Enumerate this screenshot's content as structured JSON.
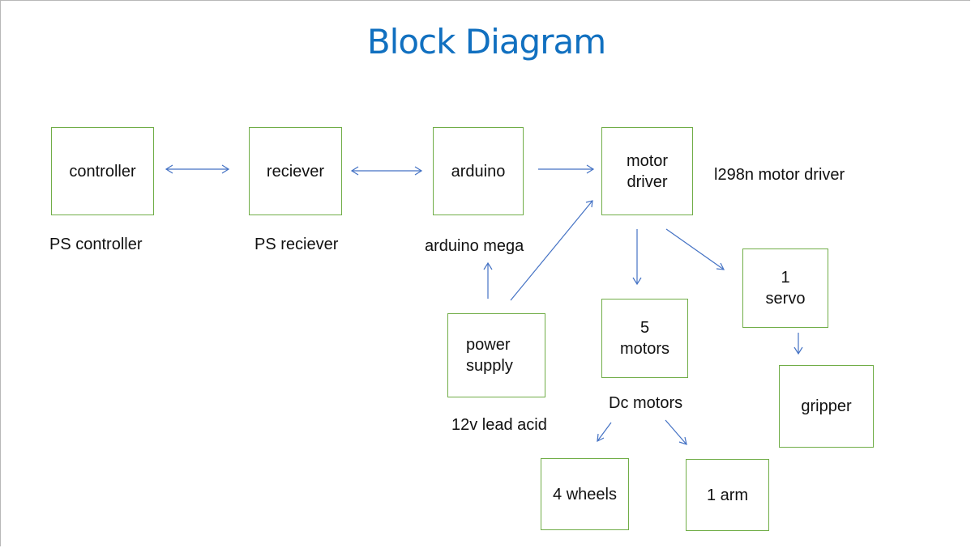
{
  "title": "Block Diagram",
  "colors": {
    "title": "#1170c0",
    "box_border": "#70ad47",
    "arrow": "#4472c4"
  },
  "blocks": {
    "controller": {
      "text": "controller",
      "label": "PS controller"
    },
    "receiver": {
      "text": "reciever",
      "label": "PS reciever"
    },
    "arduino": {
      "text": "arduino",
      "label": "arduino mega"
    },
    "motor_driver": {
      "line1": "motor",
      "line2": "driver",
      "label": "l298n motor driver"
    },
    "power_supply": {
      "line1": "power",
      "line2": "supply",
      "label": "12v lead acid"
    },
    "motors": {
      "line1": "5",
      "line2": "motors",
      "label": "Dc motors"
    },
    "servo": {
      "line1": "1",
      "line2": "servo"
    },
    "gripper": {
      "text": "gripper"
    },
    "wheels": {
      "text": "4 wheels"
    },
    "arm": {
      "text": "1 arm"
    }
  },
  "connections": [
    {
      "from": "controller",
      "to": "receiver",
      "type": "bidirectional"
    },
    {
      "from": "receiver",
      "to": "arduino",
      "type": "bidirectional"
    },
    {
      "from": "arduino",
      "to": "motor_driver",
      "type": "directed"
    },
    {
      "from": "power_supply",
      "to": "motor_driver",
      "type": "directed"
    },
    {
      "from": "power_supply",
      "to": "arduino",
      "type": "directed"
    },
    {
      "from": "motor_driver",
      "to": "motors",
      "type": "directed"
    },
    {
      "from": "motor_driver",
      "to": "servo",
      "type": "directed"
    },
    {
      "from": "servo",
      "to": "gripper",
      "type": "directed"
    },
    {
      "from": "motors",
      "to": "wheels",
      "type": "directed"
    },
    {
      "from": "motors",
      "to": "arm",
      "type": "directed"
    }
  ]
}
